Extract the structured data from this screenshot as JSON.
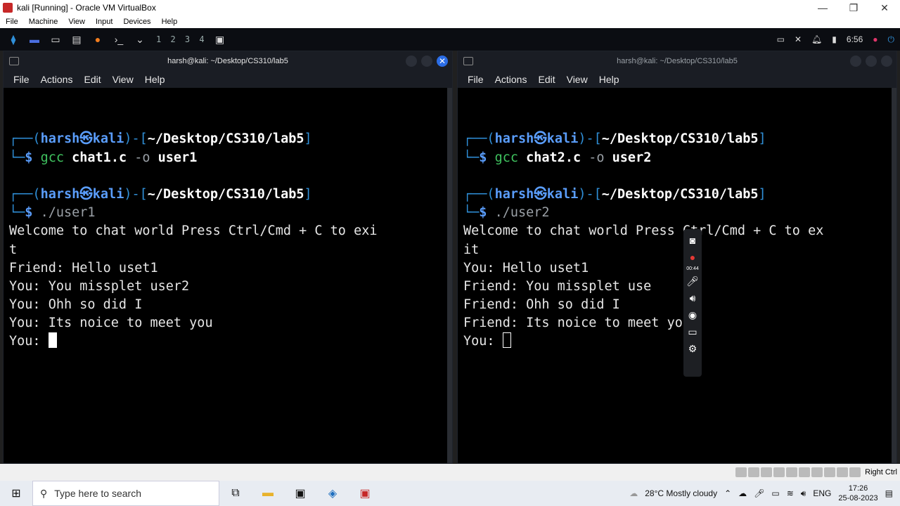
{
  "window": {
    "title": "kali [Running] - Oracle VM VirtualBox",
    "controls": [
      "—",
      "❐",
      "✕"
    ]
  },
  "vbox_menu": [
    "File",
    "Machine",
    "View",
    "Input",
    "Devices",
    "Help"
  ],
  "kali_panel": {
    "workspaces": "1 2 3 4",
    "time": "6:56"
  },
  "terminals": [
    {
      "title": "harsh@kali: ~/Desktop/CS310/lab5",
      "menu": [
        "File",
        "Actions",
        "Edit",
        "View",
        "Help"
      ],
      "prompt1_user": "harsh",
      "prompt1_host": "kali",
      "prompt1_path": "~/Desktop/CS310/lab5",
      "cmd1_word1": "gcc",
      "cmd1_file": "chat1.c",
      "cmd1_flag": "-o",
      "cmd1_out": "user1",
      "prompt2_user": "harsh",
      "prompt2_host": "kali",
      "prompt2_path": "~/Desktop/CS310/lab5",
      "cmd2": "./user1",
      "output": [
        "Welcome to chat world Press Ctrl/Cmd + C to exi",
        "t",
        "Friend: Hello uset1",
        "You: You missplet user2",
        "You: Ohh so did I",
        "You: Its noice to meet you"
      ],
      "input_prompt": "You: "
    },
    {
      "title": "harsh@kali: ~/Desktop/CS310/lab5",
      "menu": [
        "File",
        "Actions",
        "Edit",
        "View",
        "Help"
      ],
      "prompt1_user": "harsh",
      "prompt1_host": "kali",
      "prompt1_path": "~/Desktop/CS310/lab5",
      "cmd1_word1": "gcc",
      "cmd1_file": "chat2.c",
      "cmd1_flag": "-o",
      "cmd1_out": "user2",
      "prompt2_user": "harsh",
      "prompt2_host": "kali",
      "prompt2_path": "~/Desktop/CS310/lab5",
      "cmd2": "./user2",
      "output": [
        "Welcome to chat world Press Ctrl/Cmd + C to ex",
        "it",
        "You: Hello uset1",
        "Friend: You missplet use",
        "Friend: Ohh so did I",
        "Friend: Its noice to meet you"
      ],
      "input_prompt": "You: "
    }
  ],
  "recorder": {
    "timer": "00:44"
  },
  "statusbar": {
    "host_key": "Right Ctrl"
  },
  "taskbar": {
    "search_placeholder": "Type here to search",
    "weather": "28°C  Mostly cloudy",
    "lang": "ENG",
    "time": "17:26",
    "date": "25-08-2023"
  }
}
